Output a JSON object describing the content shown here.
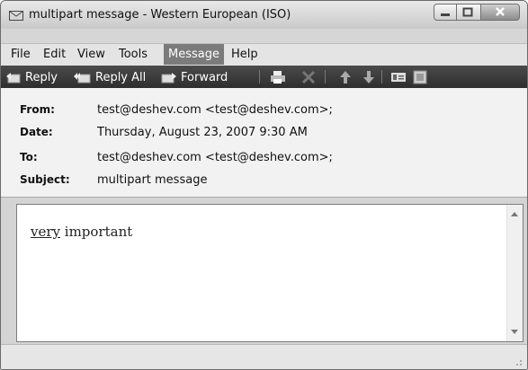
{
  "window": {
    "title": "multipart message - Western European (ISO)"
  },
  "menu": {
    "file": "File",
    "edit": "Edit",
    "view": "View",
    "tools": "Tools",
    "message": "Message",
    "help": "Help"
  },
  "toolbar": {
    "reply": "Reply",
    "reply_all": "Reply All",
    "forward": "Forward"
  },
  "header": {
    "from_label": "From:",
    "from_value": "test@deshev.com <test@deshev.com>;",
    "date_label": "Date:",
    "date_value": "Thursday, August 23, 2007 9:30 AM",
    "to_label": "To:",
    "to_value": "test@deshev.com <test@deshev.com>;",
    "subject_label": "Subject:",
    "subject_value": "multipart message"
  },
  "body": {
    "word_underlined": "very",
    "word_rest": " important"
  },
  "icons": {
    "title": "envelope-icon",
    "reply": "reply-icon",
    "reply_all": "reply-all-icon",
    "forward": "forward-icon",
    "print": "print-icon",
    "delete": "delete-icon",
    "previous": "up-arrow-icon",
    "next": "down-arrow-icon",
    "addresses": "address-book-icon",
    "contact": "contact-card-icon"
  }
}
